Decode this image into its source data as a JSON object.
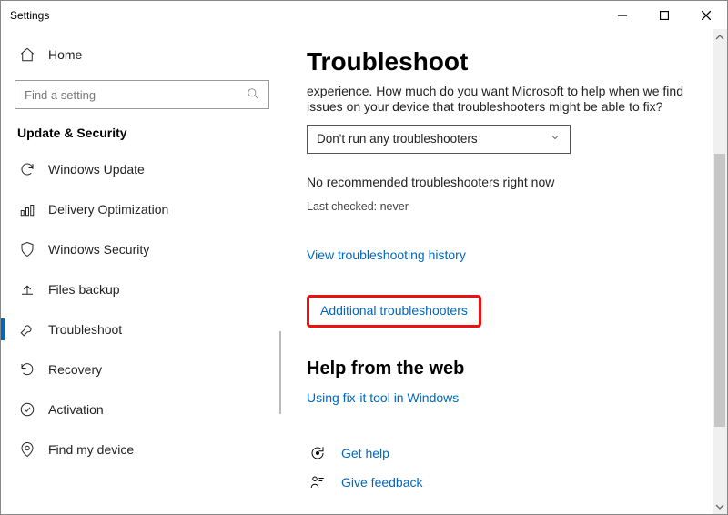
{
  "titlebar": {
    "app_name": "Settings"
  },
  "sidebar": {
    "home_label": "Home",
    "search_placeholder": "Find a setting",
    "section_label": "Update & Security",
    "items": [
      {
        "label": "Windows Update"
      },
      {
        "label": "Delivery Optimization"
      },
      {
        "label": "Windows Security"
      },
      {
        "label": "Files backup"
      },
      {
        "label": "Troubleshoot"
      },
      {
        "label": "Recovery"
      },
      {
        "label": "Activation"
      },
      {
        "label": "Find my device"
      }
    ]
  },
  "main": {
    "title": "Troubleshoot",
    "truncated_line": "experience. How much do you want Microsoft to help when we find",
    "body_line": "issues on your device that troubleshooters might be able to fix?",
    "select_value": "Don't run any troubleshooters",
    "no_recommended": "No recommended troubleshooters right now",
    "last_checked": "Last checked: never",
    "links": {
      "history": "View troubleshooting history",
      "additional": "Additional troubleshooters",
      "fixit": "Using fix-it tool in Windows",
      "gethelp": "Get help",
      "feedback": "Give feedback"
    },
    "help_heading": "Help from the web"
  }
}
